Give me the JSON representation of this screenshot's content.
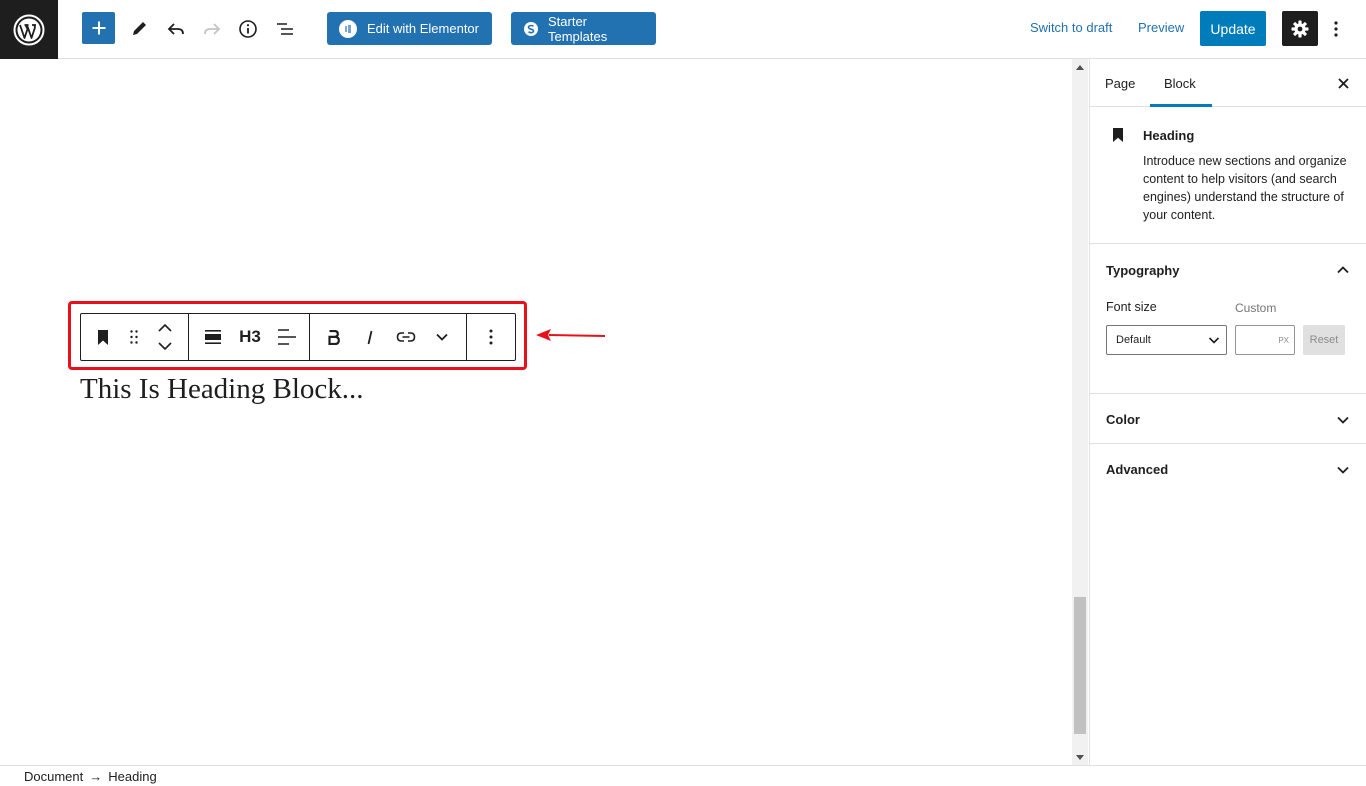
{
  "topbar": {
    "edit_elementor_label": "Edit with Elementor",
    "starter_templates_label": "Starter Templates",
    "switch_to_draft_label": "Switch to draft",
    "preview_label": "Preview",
    "update_label": "Update"
  },
  "block_toolbar": {
    "heading_level": "H3"
  },
  "canvas": {
    "heading_text": "This Is Heading Block..."
  },
  "sidebar": {
    "tabs": [
      {
        "label": "Page"
      },
      {
        "label": "Block"
      }
    ],
    "active_tab": "Block",
    "block_card": {
      "title": "Heading",
      "description": "Introduce new sections and organize content to help visitors (and search engines) understand the structure of your content."
    },
    "typography": {
      "title": "Typography",
      "expanded": true,
      "font_size_label": "Font size",
      "font_size_value": "Default",
      "custom_label": "Custom",
      "custom_value": "",
      "custom_unit": "PX",
      "reset_label": "Reset"
    },
    "color": {
      "title": "Color",
      "expanded": false
    },
    "advanced": {
      "title": "Advanced",
      "expanded": false
    }
  },
  "breadcrumb": {
    "items": [
      "Document",
      "Heading"
    ],
    "separator": "→"
  },
  "colors": {
    "primary": "#2271b1",
    "update": "#007cba",
    "highlight": "#e8111b",
    "dark": "#1e1e1e"
  }
}
